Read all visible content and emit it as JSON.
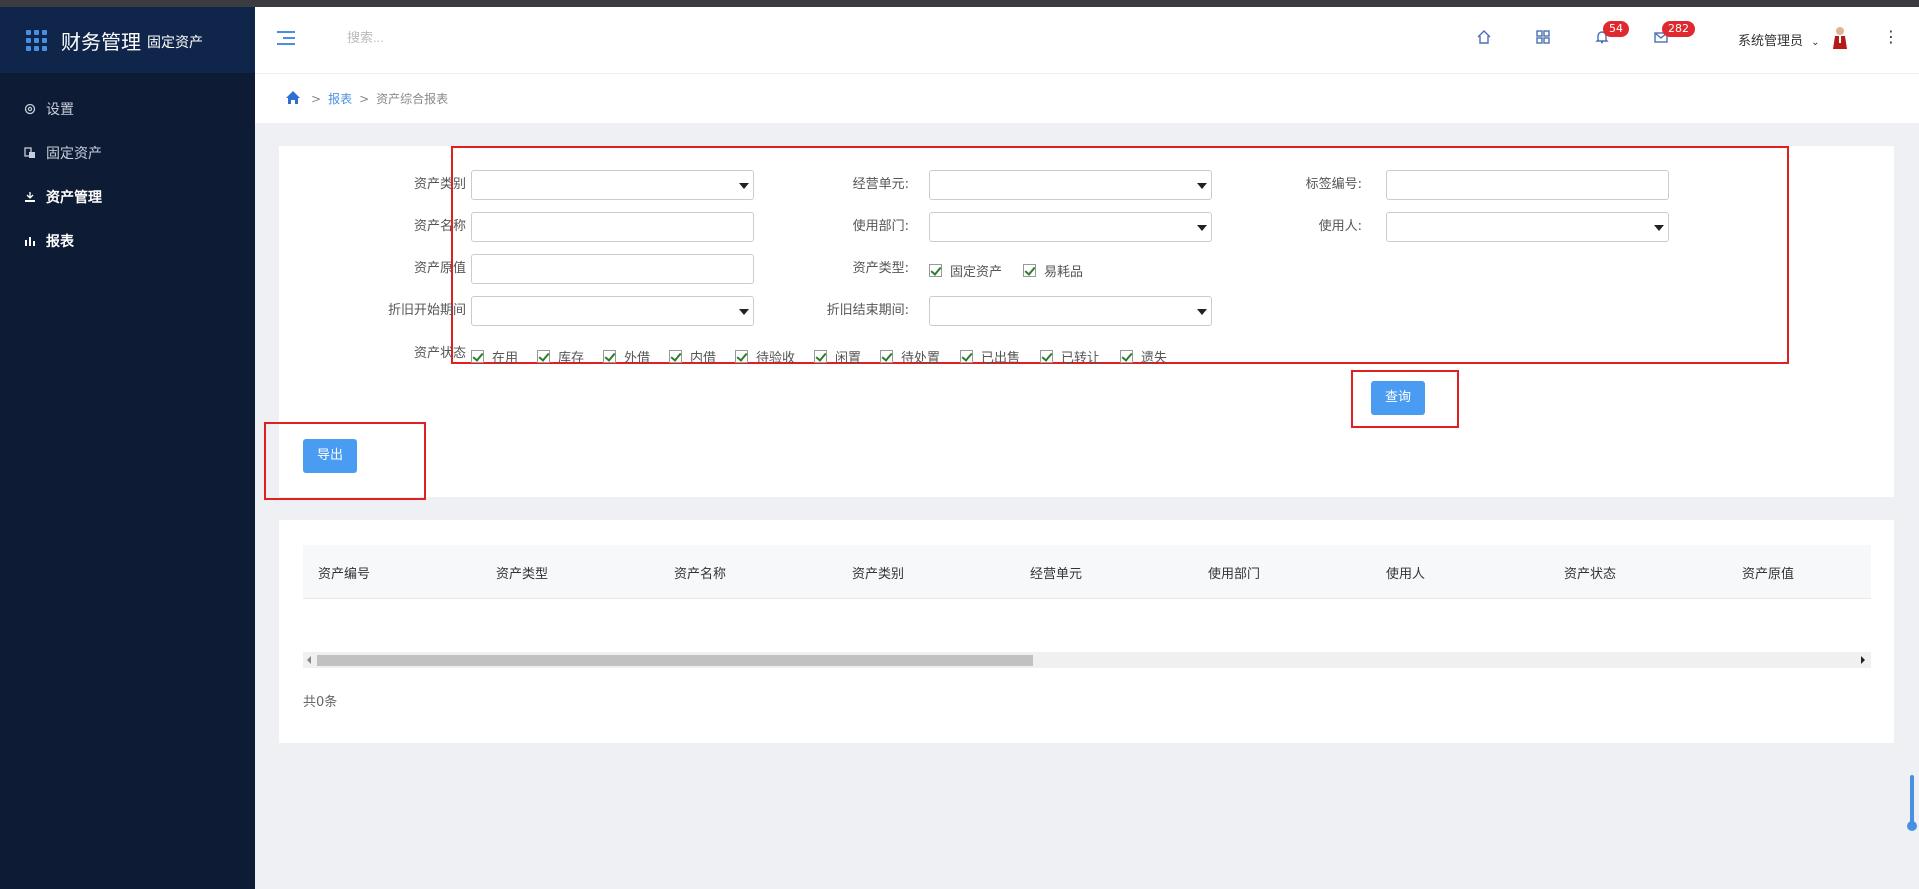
{
  "brand": {
    "title": "财务管理",
    "subtitle": "固定资产"
  },
  "sidebar": {
    "items": [
      {
        "label": "设置",
        "icon": "gear-icon"
      },
      {
        "label": "固定资产",
        "icon": "asset-icon"
      },
      {
        "label": "资产管理",
        "icon": "manage-icon"
      },
      {
        "label": "报表",
        "icon": "chart-icon"
      }
    ]
  },
  "header": {
    "search_placeholder": "搜索...",
    "notifications_count": "54",
    "messages_count": "282",
    "user_name": "系统管理员"
  },
  "breadcrumb": {
    "sep": ">",
    "items": [
      "报表",
      "资产综合报表"
    ]
  },
  "form": {
    "asset_category_label": "资产类别",
    "business_unit_label": "经营单元:",
    "tag_no_label": "标签编号:",
    "asset_name_label": "资产名称",
    "department_label": "使用部门:",
    "user_label": "使用人:",
    "original_value_label": "资产原值",
    "asset_type_label": "资产类型:",
    "asset_type_options": [
      "固定资产",
      "易耗品"
    ],
    "dep_start_label": "折旧开始期间",
    "dep_end_label": "折旧结束期间:",
    "status_label": "资产状态",
    "status_options": [
      "在用",
      "库存",
      "外借",
      "内借",
      "待验收",
      "闲置",
      "待处置",
      "已出售",
      "已转让",
      "遗失"
    ],
    "query_button": "查询",
    "export_button": "导出"
  },
  "table": {
    "columns": [
      "资产编号",
      "资产类型",
      "资产名称",
      "资产类别",
      "经营单元",
      "使用部门",
      "使用人",
      "资产状态",
      "资产原值"
    ],
    "rows": [],
    "total_text": "共0条"
  },
  "colors": {
    "sidebar": "#0d1b35",
    "accent": "#4a9bf2",
    "highlight_box": "#e02020",
    "badge": "#e0292e"
  }
}
